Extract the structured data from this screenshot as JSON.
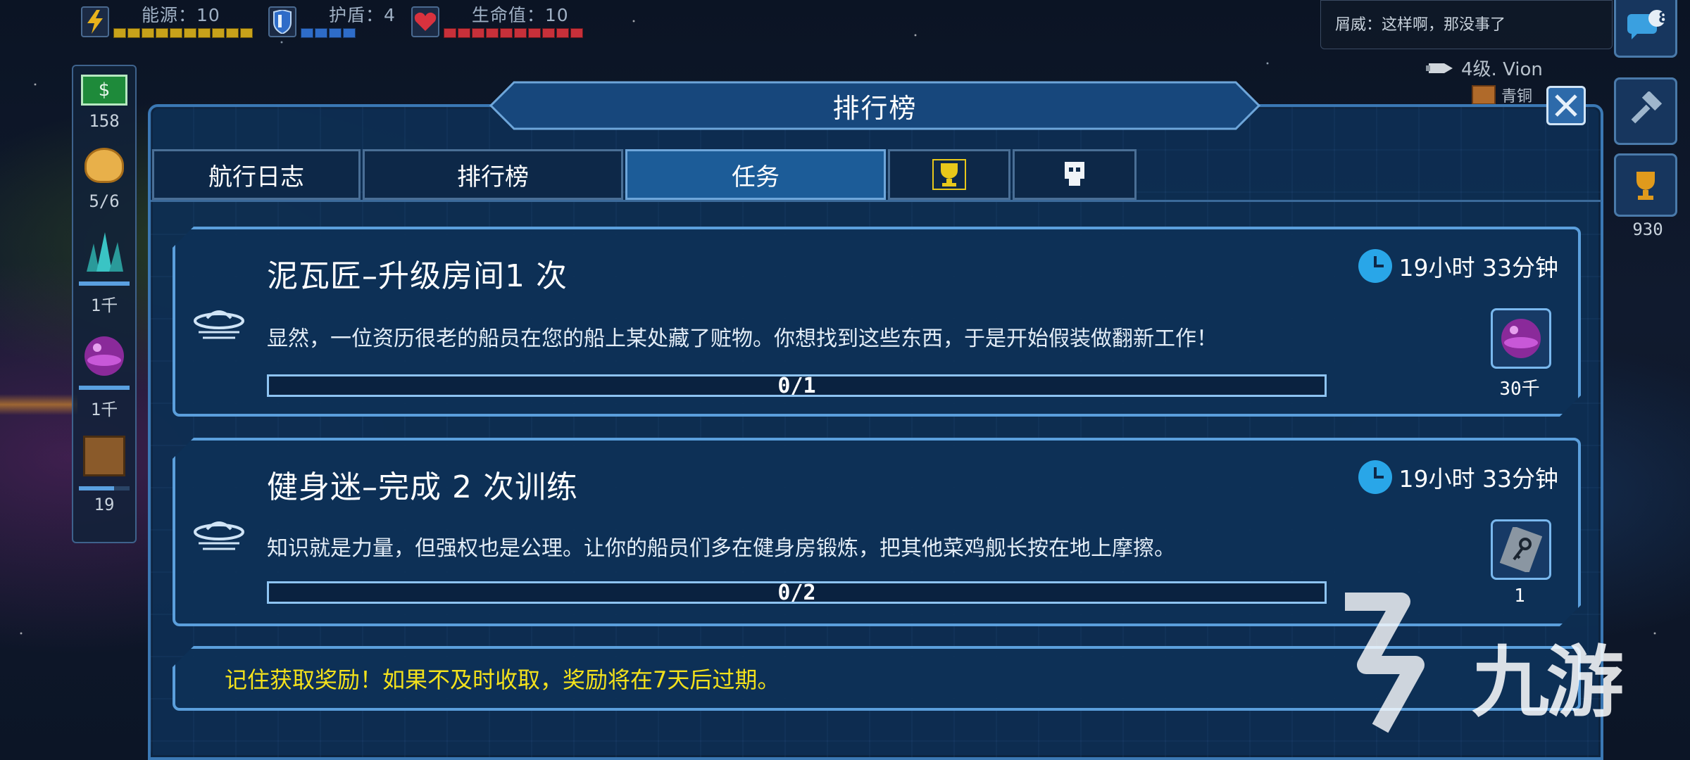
{
  "hud": {
    "energy": {
      "label": "能源：10",
      "filled": 10,
      "total": 10,
      "color": "#c8a21a"
    },
    "shield": {
      "label": "护盾：4",
      "filled": 4,
      "total": 4,
      "color": "#2e6cc8"
    },
    "hull": {
      "label": "生命值：10",
      "filled": 10,
      "total": 10,
      "color": "#c8303a"
    }
  },
  "chat": {
    "message": "屑威：这样啊，那没事了",
    "badge": "8"
  },
  "player": {
    "level": "4级. Vion",
    "sub": "青铜"
  },
  "right_panel": {
    "trophy_count": "930"
  },
  "sidebar": {
    "money": "158",
    "crew": "5/6",
    "mineral": "1千",
    "gas": "1千",
    "supplies": "19"
  },
  "panel": {
    "title": "排行榜"
  },
  "tabs": [
    {
      "label": "航行日志",
      "active": false
    },
    {
      "label": "排行榜",
      "active": false
    },
    {
      "label": "任务",
      "active": true
    },
    {
      "label": "",
      "icon": "trophy-icon",
      "active": false
    },
    {
      "label": "",
      "icon": "skull-icon",
      "active": false
    }
  ],
  "quests": [
    {
      "title": "泥瓦匠–升级房间1 次",
      "time": "19小时 33分钟",
      "description": "显然，一位资历很老的船员在您的船上某处藏了赃物。你想找到这些东西，于是开始假装做翻新工作！",
      "progress": "0/1",
      "progress_fraction": 0,
      "reward_icon": "gas-orb-icon",
      "reward_qty": "30千"
    },
    {
      "title": "健身迷–完成 2 次训练",
      "time": "19小时 33分钟",
      "description": "知识就是力量，但强权也是公理。让你的船员们多在健身房锻炼，把其他菜鸡舰长按在地上摩擦。",
      "progress": "0/2",
      "progress_fraction": 0,
      "reward_icon": "key-card-icon",
      "reward_qty": "1"
    }
  ],
  "notice": "记住获取奖励！如果不及时收取，奖励将在7天后过期。",
  "watermark": "九游"
}
